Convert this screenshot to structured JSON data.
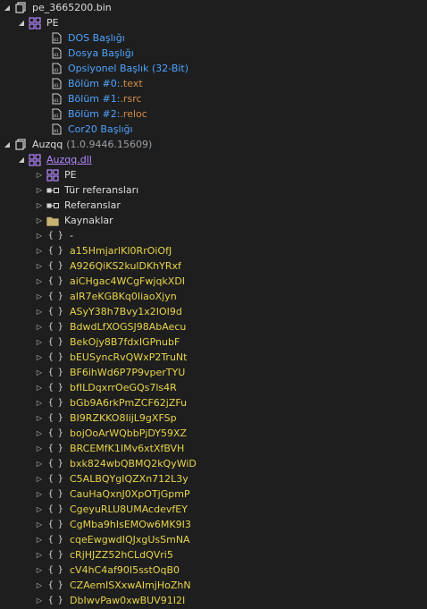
{
  "file": {
    "name": "pe_3665200.bin",
    "pe": "PE"
  },
  "pe_children": [
    {
      "label": "DOS Başlığı"
    },
    {
      "label": "Dosya Başlığı"
    },
    {
      "label": "Opsiyonel Başlık (32-Bit)"
    },
    {
      "label_a": "Bölüm #0: ",
      "label_b": ".text"
    },
    {
      "label_a": "Bölüm #1: ",
      "label_b": ".rsrc"
    },
    {
      "label_a": "Bölüm #2: ",
      "label_b": ".reloc"
    },
    {
      "label": "Cor20 Başlığı"
    }
  ],
  "assembly": {
    "name": "Auzqq",
    "version": "(1.0.9446.15609)"
  },
  "module": {
    "name": "Auzqq.dll",
    "items": [
      {
        "label": "PE"
      },
      {
        "label": "Tür referansları"
      },
      {
        "label": "Referanslar"
      },
      {
        "label": "Kaynaklar"
      }
    ]
  },
  "namespaces": [
    "-",
    "a15HmjarlKI0RrOiOfJ",
    "A926QiKS2kulDKhYRxf",
    "aiCHgac4WCgFwjqkXDI",
    "aIR7eKGBKq0IiaoXjyn",
    "ASyY38h7Bvy1x2IOI9d",
    "BdwdLfXOGSJ98AbAecu",
    "BekOjy8B7fdxIGPnubF",
    "bEUSyncRvQWxP2TruNt",
    "BF6ihWd6P7P9vperTYU",
    "bfILDqxrrOeGQs7ls4R",
    "bGb9A6rkPmZCF62jZFu",
    "BI9RZKKO8IijL9gXFSp",
    "bojOoArWQbbPjDY59XZ",
    "BRCEMfK1IMv6xtXfBVH",
    "bxk824wbQBMQ2kQyWiD",
    "C5ALBQYgIQZXn712L3y",
    "CauHaQxnJ0XpOTjGpmP",
    "CgeyuRLU8UMAcdevfEY",
    "CgMba9hIsEMOw6MK9I3",
    "cqeEwgwdIQJxgUsSmNA",
    "cRjHJZZ52hCLdQVri5",
    "cV4hC4af90I5sstOqB0",
    "CZAemISXxwAImjHoZhN",
    "DbIwvPaw0xwBUV91I2I"
  ],
  "icons": {
    "binary_file": "binary-file-icon",
    "brackets": "namespace-braces-icon",
    "folder": "folder-icon",
    "refs": "references-icon",
    "assembly": "assembly-icon",
    "module": "module-icon",
    "pe": "pe-icon"
  }
}
